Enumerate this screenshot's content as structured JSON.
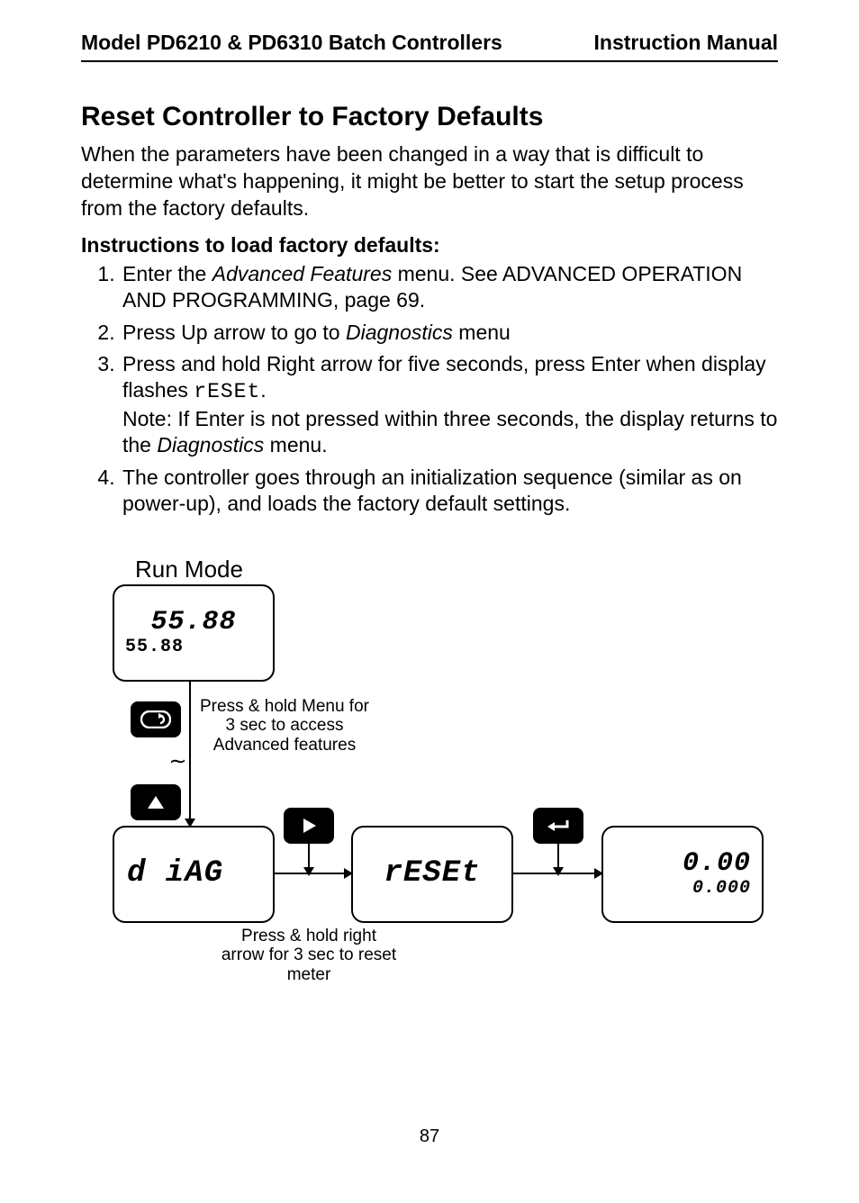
{
  "header": {
    "left": "Model PD6210 & PD6310 Batch Controllers",
    "right": "Instruction Manual"
  },
  "section_title": "Reset Controller to Factory Defaults",
  "intro": "When the parameters have been changed in a way that is difficult to determine what's happening, it might be better to start the setup process from the factory defaults.",
  "subhead": "Instructions to load factory defaults:",
  "steps": {
    "s1a": "Enter the ",
    "s1b": "Advanced Features",
    "s1c": " menu. See ADVANCED OPERATION AND PROGRAMMING, page 69.",
    "s2a": "Press Up arrow to go to ",
    "s2b": "Diagnostics",
    "s2c": " menu",
    "s3a": "Press and hold Right arrow for five seconds, press Enter when display flashes ",
    "s3b": "rESEt",
    "s3c": ".",
    "s3d": "Note: If Enter is not pressed within three seconds, the display returns to the ",
    "s3e": "Diagnostics",
    "s3f": " menu.",
    "s4": "The controller goes through an initialization sequence (similar as on power-up), and loads the factory default settings."
  },
  "diagram": {
    "run_mode_label": "Run Mode",
    "screen_run_big": "55.88",
    "screen_run_small": "55.88",
    "screen_diag": "d iAG",
    "screen_reset": "rESEt",
    "screen_zero_big": "0.00",
    "screen_zero_small": "0.000",
    "note_menu": "Press & hold Menu  for 3 sec to access Advanced features",
    "note_reset": "Press & hold right arrow for 3 sec to reset meter",
    "buttons": {
      "menu": "menu-button",
      "up": "up-arrow-button",
      "right": "right-arrow-button",
      "enter": "enter-button"
    }
  },
  "page_number": "87"
}
